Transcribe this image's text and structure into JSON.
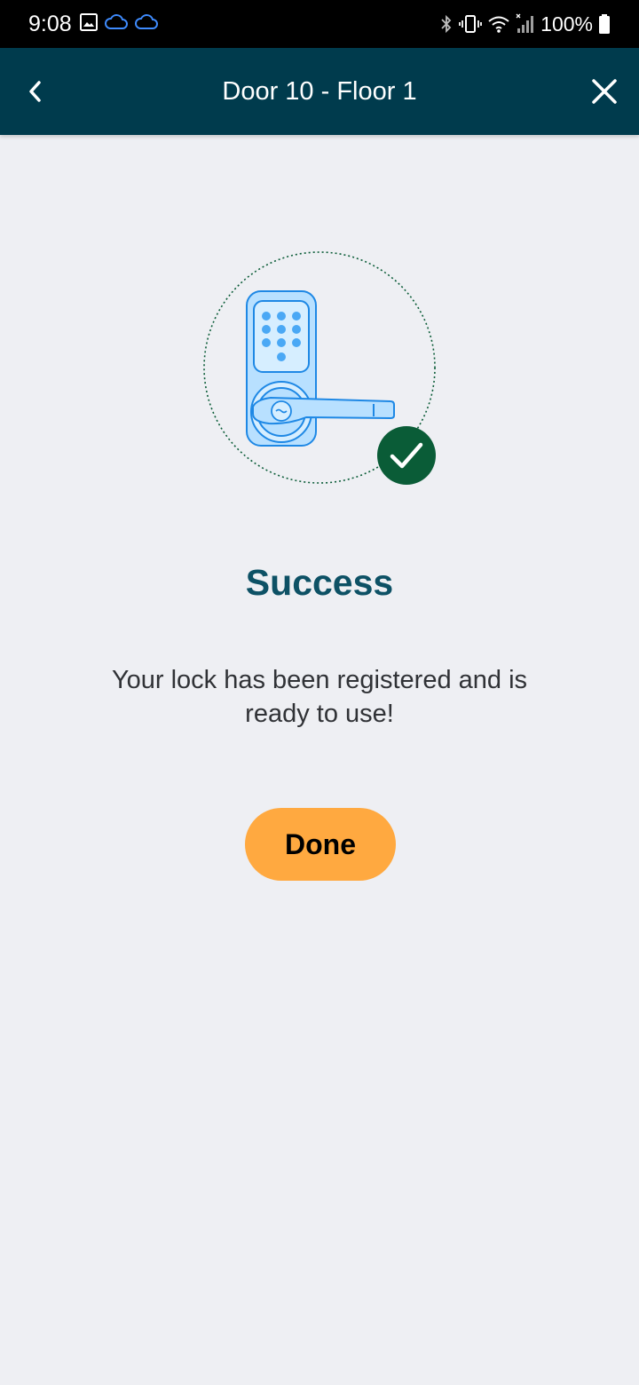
{
  "status_bar": {
    "time": "9:08",
    "battery": "100%",
    "icons": [
      "image-icon",
      "cloud-icon",
      "cloud-icon",
      "bluetooth-icon",
      "vibrate-icon",
      "wifi-icon",
      "signal-icon",
      "battery-icon"
    ]
  },
  "header": {
    "title": "Door 10 - Floor 1",
    "back_icon": "chevron-left-icon",
    "close_icon": "close-icon"
  },
  "illustration": {
    "subject": "lock-icon",
    "badge": "check-icon"
  },
  "content": {
    "title": "Success",
    "message": "Your lock has been registered and is ready to use!"
  },
  "actions": {
    "done_label": "Done"
  },
  "colors": {
    "header_bg": "#003b4d",
    "title": "#0d5165",
    "done_button": "#ffa940",
    "success_badge": "#0a5c37",
    "lock_blue": "#2196f3",
    "background": "#eeeff3"
  }
}
